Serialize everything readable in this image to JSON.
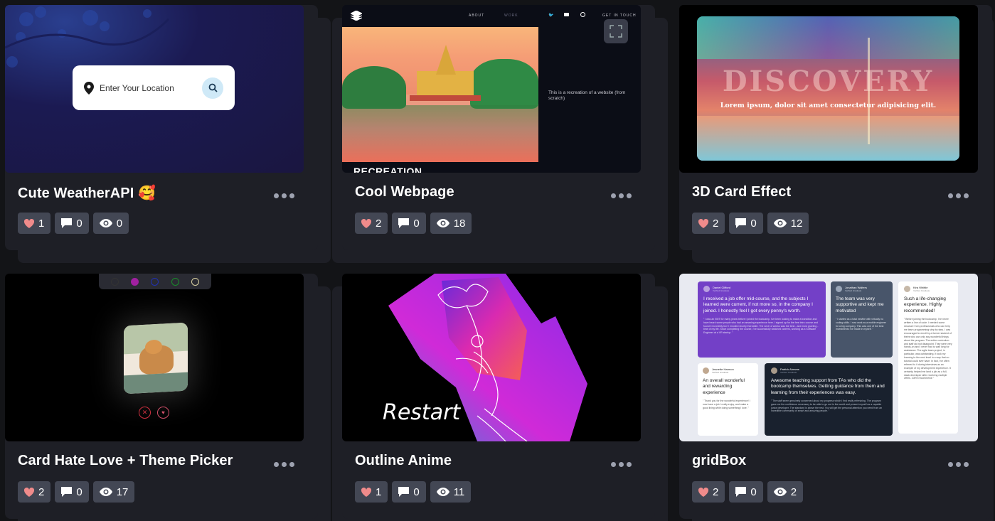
{
  "cards": [
    {
      "title": "Cute WeatherAPI 🥰",
      "likes": "1",
      "comments": "0",
      "views": "0"
    },
    {
      "title": "Cool Webpage",
      "likes": "2",
      "comments": "0",
      "views": "18"
    },
    {
      "title": "3D Card Effect",
      "likes": "2",
      "comments": "0",
      "views": "12"
    },
    {
      "title": "Card Hate Love + Theme Picker",
      "likes": "2",
      "comments": "0",
      "views": "17"
    },
    {
      "title": "Outline Anime",
      "likes": "1",
      "comments": "0",
      "views": "11"
    },
    {
      "title": "gridBox",
      "likes": "2",
      "comments": "0",
      "views": "2"
    }
  ],
  "weather": {
    "placeholder": "Enter Your Location"
  },
  "webpage": {
    "nav_about": "ABOUT",
    "nav_work": "WORK",
    "nav_contact": "GET IN TOUCH",
    "caption": "This is a recreation of a website (from scratch)",
    "heading": "RECREATION"
  },
  "discovery": {
    "title": "DISCOVERY",
    "subtitle": "Lorem ipsum, dolor sit amet consectetur adipisicing elit."
  },
  "outline": {
    "restart": "Restart"
  },
  "gridbox": {
    "t1_name": "Daniel Clifford",
    "t1_role": "Verified Graduate",
    "t1_head": "I received a job offer mid-course, and the subjects I learned were current, if not more so, in the company I joined. I honestly feel I got every penny's worth.",
    "t1_body": "\" I was an EMT for many years before I joined the bootcamp. I've been looking to make a transition and have heard some people who had an amazing experience here. I signed up for the free intro course and found it incredibly fun! I enrolled shortly thereafter. The next 12 weeks was the best - and most grueling - time of my life. Since completing the course, I've successfully switched careers, working as a Software Engineer at a VR startup. \"",
    "t2_name": "Jonathan Walters",
    "t2_role": "Verified Graduate",
    "t2_head": "The team was very supportive and kept me motivated",
    "t2_body": "\" I started as a total newbie with virtually no coding skills. I now work as a mobile engineer for a big company. This was one of the best investments I've made in myself. \"",
    "t3_name": "Kira Whittle",
    "t3_role": "Verified Graduate",
    "t3_head": "Such a life-changing experience. Highly recommended!",
    "t3_body": "\" Before joining the bootcamp, I've never written a line of code. I needed some structure from professionals who can help me learn programming step by step. I was encouraged to enroll by a former student of theirs who can only say wonderful things about the program. The entire curriculum and staff did not disappoint. They were very hands-on and I never had to wait long for assistance. The agile team project, in particular, was outstanding. It took my learning to the next level in a way that no tutorial could ever have. In fact, I've often referred to it during interviews as an example of my development experience. It certainly helped me land a job as a full-stack developer after receiving multiple offers. 100% recommend! \"",
    "t4_name": "Jeanette Harmon",
    "t4_role": "Verified Graduate",
    "t4_head": "An overall wonderful and rewarding experience",
    "t4_body": "\" Thank you for the wonderful experience! I now have a job I really enjoy, and make a good living while doing something I love. \"",
    "t5_name": "Patrick Abrams",
    "t5_role": "Verified Graduate",
    "t5_head": "Awesome teaching support from TAs who did the bootcamp themselves. Getting guidance from them and learning from their experiences was easy.",
    "t5_body": "\" The staff seem genuinely concerned about my progress which I find really refreshing. The program gave me the confidence necessary to be able to go out in the world and present myself as a capable junior developer. The standard is above the rest. You will get the personal attention you need from an incredible community of smart and amazing people. \""
  },
  "colors": {
    "page_bg": "#131417",
    "card_bg": "#1e1f26",
    "stat_bg": "#434754",
    "heart": "#f08b8b"
  }
}
